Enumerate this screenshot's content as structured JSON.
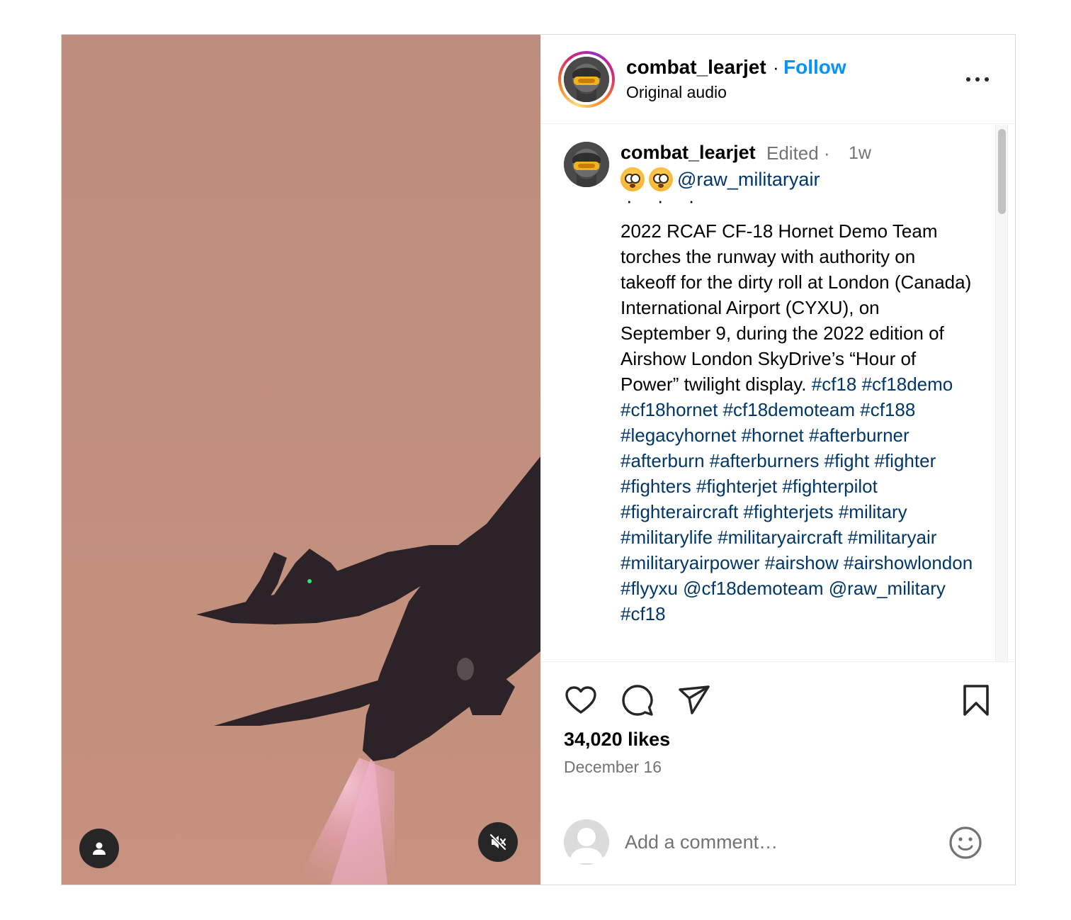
{
  "post": {
    "username": "combat_learjet",
    "separator": "·",
    "follow_label": "Follow",
    "audio_label": "Original audio",
    "more_label": "More options"
  },
  "caption": {
    "username": "combat_learjet",
    "edited_label": "Edited ·",
    "time_ago": "1w",
    "mention": "@raw_militaryair",
    "dots": "· · ·",
    "text": "2022 RCAF CF-18 Hornet Demo Team torches the runway with authority on takeoff for the dirty roll at London (Canada) International Airport (CYXU), on September 9, during the 2022 edition of Airshow London SkyDrive’s “Hour of Power” twilight display.",
    "hashtags": [
      "#cf18",
      "#cf18demo",
      "#cf18hornet",
      "#cf18demoteam",
      "#cf188",
      "#legacyhornet",
      "#hornet",
      "#afterburner",
      "#afterburn",
      "#afterburners",
      "#fight",
      "#fighter",
      "#fighters",
      "#fighterjet",
      "#fighterpilot",
      "#fighteraircraft",
      "#fighterjets",
      "#military",
      "#militarylife",
      "#militaryaircraft",
      "#militaryair",
      "#militaryairpower",
      "#airshow",
      "#airshowlondon",
      "#flyyxu",
      "@cf18demoteam",
      "@raw_military",
      "#cf18"
    ]
  },
  "stats": {
    "likes": "34,020 likes",
    "date": "December 16"
  },
  "comment_box": {
    "placeholder": "Add a comment…"
  },
  "colors": {
    "accent": "#0095f6",
    "link": "#00376b",
    "muted": "#737373",
    "border": "#dbdbdb"
  },
  "icons": {
    "tag": "person-icon",
    "mute": "speaker-muted-icon",
    "like": "heart-icon",
    "comment": "speech-bubble-icon",
    "share": "paper-plane-icon",
    "save": "bookmark-icon",
    "emoji": "smiley-icon"
  }
}
